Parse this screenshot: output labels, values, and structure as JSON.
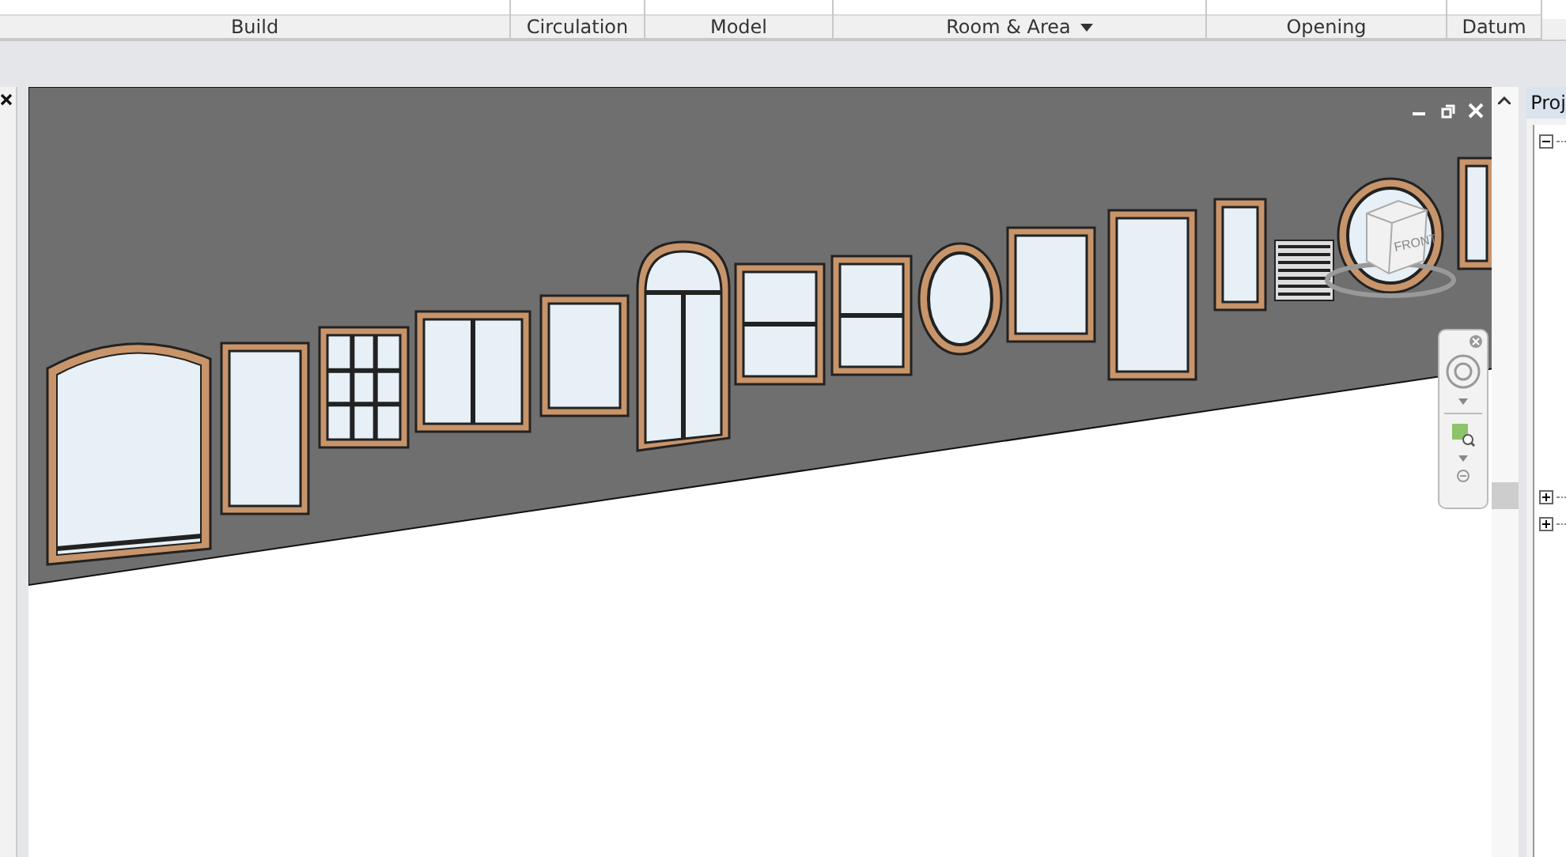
{
  "ribbon": {
    "panels": [
      {
        "label": "Build",
        "has_menu": false
      },
      {
        "label": "Circulation",
        "has_menu": false
      },
      {
        "label": "Model",
        "has_menu": false
      },
      {
        "label": "Room & Area",
        "has_menu": true
      },
      {
        "label": "Opening",
        "has_menu": false
      },
      {
        "label": "Datum",
        "has_menu": false
      }
    ]
  },
  "view": {
    "view_cube_label": "FRONT"
  },
  "project_browser": {
    "title": "Proj",
    "nodes": [
      {
        "expanded": true
      },
      {
        "expanded": false
      },
      {
        "expanded": false
      }
    ]
  }
}
